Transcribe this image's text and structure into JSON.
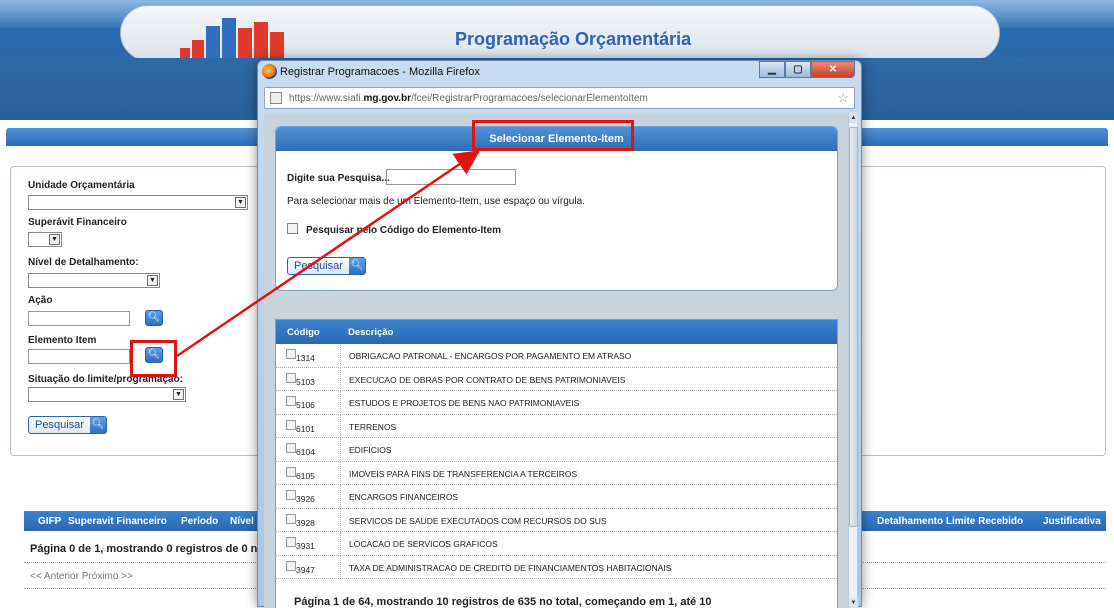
{
  "app": {
    "title": "Programação Orçamentária",
    "form": {
      "unidade_label": "Unidade Orçamentária",
      "superavit_label": "Superávit Financeiro",
      "nivel_label": "Nível de Detalhamento:",
      "acao_label": "Ação",
      "elemento_label": "Elemento Item",
      "situacao_label": "Situação do limite/programação:",
      "pesquisar_label": "Pesquisar"
    },
    "results": {
      "columns": [
        "GIFP",
        "Superavit Financeiro",
        "Período",
        "Nível De",
        "Detalhamento Limite Recebido",
        "Justificativa"
      ],
      "info": "Página 0 de 1, mostrando 0 registros de 0 n",
      "pager": "<< Anterior Próximo >>"
    }
  },
  "popup": {
    "window_title": "Registrar Programacoes - Mozilla Firefox",
    "url_prefix": "https://www.siafi.",
    "url_host": "mg.gov.br",
    "url_path": "/fcei/RegistrarProgramacoes/selecionarElementoItem",
    "card_title": "Selecionar Elemento-Item",
    "search_label": "Digite sua Pesquisa...",
    "hint": "Para selecionar mais de um Elemento-Item, use espaço ou vírgula.",
    "checkbox_label": "Pesquisar pelo Código do Elemento-Item",
    "search_button": "Pesquisar",
    "table": {
      "col_code": "Código",
      "col_desc": "Descrição",
      "rows": [
        {
          "code": "1314",
          "desc": "OBRIGACAO PATRONAL - ENCARGOS POR PAGAMENTO EM ATRASO"
        },
        {
          "code": "5103",
          "desc": "EXECUCAO DE OBRAS POR CONTRATO DE BENS PATRIMONIAVEIS"
        },
        {
          "code": "5106",
          "desc": "ESTUDOS E PROJETOS DE BENS NAO PATRIMONIAVEIS"
        },
        {
          "code": "6101",
          "desc": "TERRENOS"
        },
        {
          "code": "6104",
          "desc": "EDIFICIOS"
        },
        {
          "code": "6105",
          "desc": "IMOVEIS PARA FINS DE TRANSFERENCIA A TERCEIROS"
        },
        {
          "code": "3926",
          "desc": "ENCARGOS FINANCEIROS"
        },
        {
          "code": "3928",
          "desc": "SERVICOS DE SAUDE EXECUTADOS COM RECURSOS DO SUS"
        },
        {
          "code": "3931",
          "desc": "LOCACAO DE SERVICOS GRAFICOS"
        },
        {
          "code": "3947",
          "desc": "TAXA DE ADMINISTRACAO DE CREDITO DE FINANCIAMENTOS HABITACIONAIS"
        }
      ],
      "footer": "Página 1 de 64, mostrando 10 registros de 635 no total, começando em 1, até 10"
    }
  },
  "colors": {
    "accent_blue": "#2d6db5",
    "annotation_red": "#e21212"
  }
}
